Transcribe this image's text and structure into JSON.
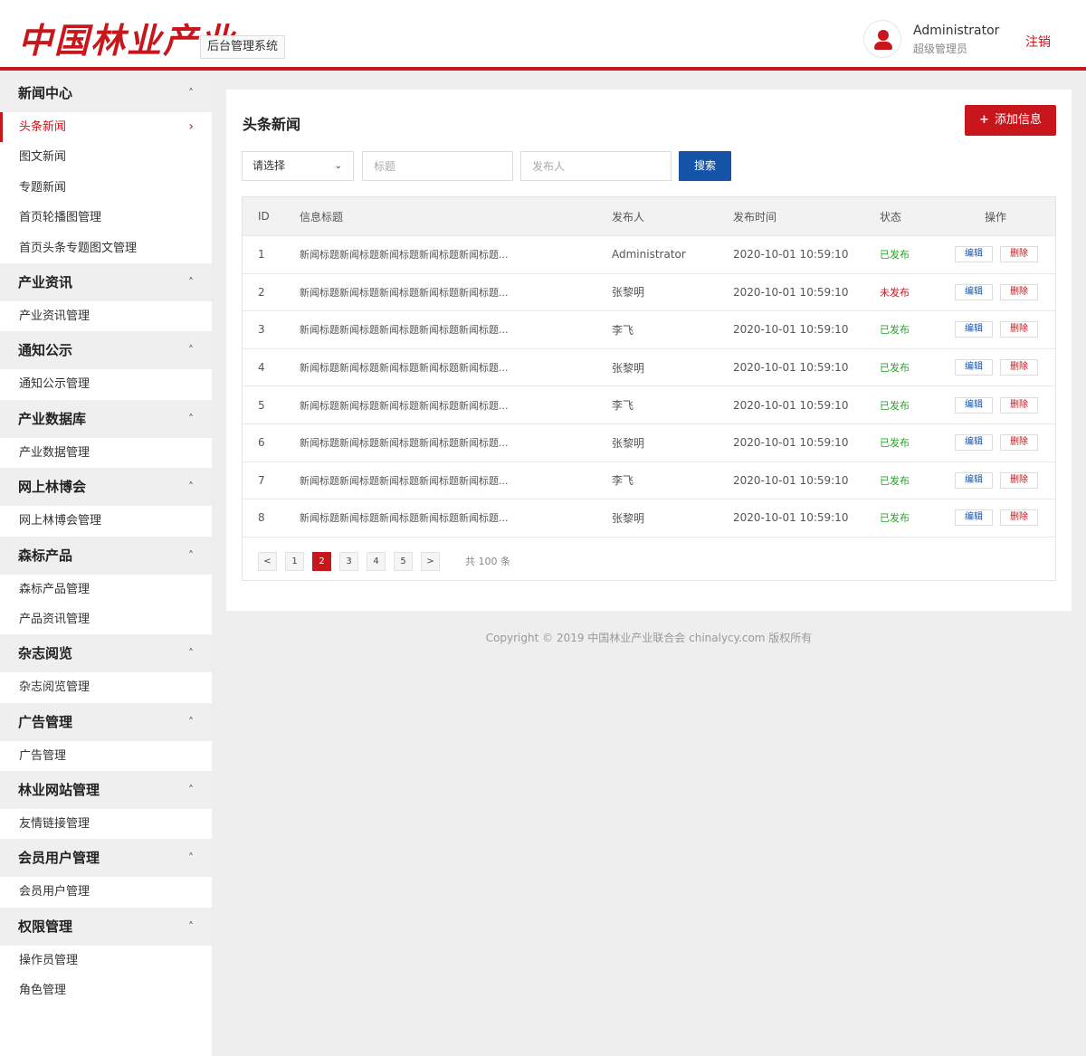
{
  "header": {
    "logo_text": "中国林业产业",
    "system_tag": "后台管理系统",
    "user_name": "Administrator",
    "user_role": "超级管理员",
    "logout_label": "注销"
  },
  "sidebar": {
    "groups": [
      {
        "title": "新闻中心",
        "items": [
          "头条新闻",
          "图文新闻",
          "专题新闻",
          "首页轮播图管理",
          "首页头条专题图文管理"
        ]
      },
      {
        "title": "产业资讯",
        "items": [
          "产业资讯管理"
        ]
      },
      {
        "title": "通知公示",
        "items": [
          "通知公示管理"
        ]
      },
      {
        "title": "产业数据库",
        "items": [
          "产业数据管理"
        ]
      },
      {
        "title": "网上林博会",
        "items": [
          "网上林博会管理"
        ]
      },
      {
        "title": "森标产品",
        "items": [
          "森标产品管理",
          "产品资讯管理"
        ]
      },
      {
        "title": "杂志阅览",
        "items": [
          "杂志阅览管理"
        ]
      },
      {
        "title": "广告管理",
        "items": [
          "广告管理"
        ]
      },
      {
        "title": "林业网站管理",
        "items": [
          "友情链接管理"
        ]
      },
      {
        "title": "会员用户管理",
        "items": [
          "会员用户管理"
        ]
      },
      {
        "title": "权限管理",
        "items": [
          "操作员管理",
          "角色管理"
        ]
      }
    ],
    "active_item": "头条新闻"
  },
  "main": {
    "title": "头条新闻",
    "add_button": "添加信息",
    "filters": {
      "select_value": "请选择",
      "title_placeholder": "标题",
      "publisher_placeholder": "发布人",
      "search_button": "搜索"
    },
    "table": {
      "headers": {
        "id": "ID",
        "title": "信息标题",
        "publisher": "发布人",
        "time": "发布时间",
        "status": "状态",
        "ops": "操作"
      },
      "rows": [
        {
          "id": "1",
          "title": "新闻标题新闻标题新闻标题新闻标题新闻标题...",
          "publisher": "Administrator",
          "time": "2020-10-01 10:59:10",
          "status": "已发布",
          "published": true
        },
        {
          "id": "2",
          "title": "新闻标题新闻标题新闻标题新闻标题新闻标题...",
          "publisher": "张黎明",
          "time": "2020-10-01 10:59:10",
          "status": "未发布",
          "published": false
        },
        {
          "id": "3",
          "title": "新闻标题新闻标题新闻标题新闻标题新闻标题...",
          "publisher": "李飞",
          "time": "2020-10-01 10:59:10",
          "status": "已发布",
          "published": true
        },
        {
          "id": "4",
          "title": "新闻标题新闻标题新闻标题新闻标题新闻标题...",
          "publisher": "张黎明",
          "time": "2020-10-01 10:59:10",
          "status": "已发布",
          "published": true
        },
        {
          "id": "5",
          "title": "新闻标题新闻标题新闻标题新闻标题新闻标题...",
          "publisher": "李飞",
          "time": "2020-10-01 10:59:10",
          "status": "已发布",
          "published": true
        },
        {
          "id": "6",
          "title": "新闻标题新闻标题新闻标题新闻标题新闻标题...",
          "publisher": "张黎明",
          "time": "2020-10-01 10:59:10",
          "status": "已发布",
          "published": true
        },
        {
          "id": "7",
          "title": "新闻标题新闻标题新闻标题新闻标题新闻标题...",
          "publisher": "李飞",
          "time": "2020-10-01 10:59:10",
          "status": "已发布",
          "published": true
        },
        {
          "id": "8",
          "title": "新闻标题新闻标题新闻标题新闻标题新闻标题...",
          "publisher": "张黎明",
          "time": "2020-10-01 10:59:10",
          "status": "已发布",
          "published": true
        }
      ],
      "edit_label": "编辑",
      "delete_label": "删除"
    },
    "pagination": {
      "prev": "<",
      "next": ">",
      "pages": [
        "1",
        "2",
        "3",
        "4",
        "5"
      ],
      "current": "2",
      "total_text": "共 100 条"
    }
  },
  "footer": {
    "copyright": "Copyright © 2019 中国林业产业联合会 chinalycy.com 版权所有"
  },
  "colors": {
    "brand_red": "#c8161d",
    "primary_blue": "#1654a8",
    "status_green": "#2aa12a"
  }
}
